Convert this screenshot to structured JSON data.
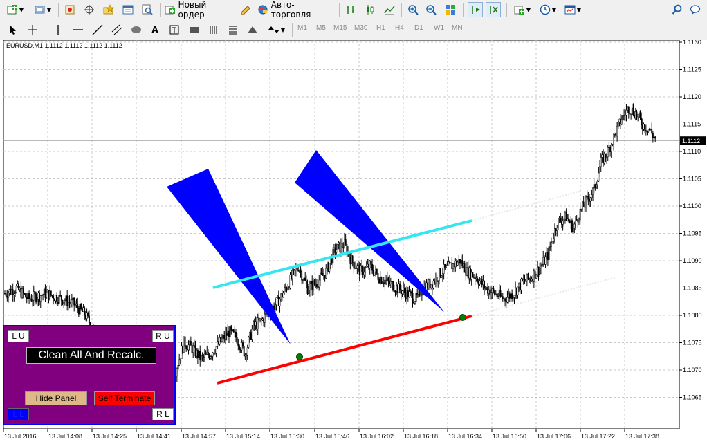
{
  "toolbar_main": {
    "new_order_label": "Новый ордер",
    "autotrading_label": "Авто-торговля"
  },
  "toolbar_draw": {
    "text_tool_label": "A",
    "timeframes": [
      "M1",
      "M5",
      "M15",
      "M30",
      "H1",
      "H4",
      "D1",
      "W1",
      "MN"
    ]
  },
  "chart": {
    "header": "EURUSD,M1  1.1112 1.1112 1.1112 1.1112",
    "current_price": "1.1112",
    "colors": {
      "background": "#ffffff",
      "grid": "#c8c8c8",
      "candles": "#000000",
      "triangles": "#0000ff",
      "upper_line": "#33e6f0",
      "lower_line": "#ff0000",
      "pivot": "#008000"
    }
  },
  "chart_data": {
    "type": "candlestick",
    "symbol": "EURUSD",
    "timeframe": "M1",
    "y_ticks": [
      "1.1130",
      "1.1125",
      "1.1120",
      "1.1115",
      "1.1110",
      "1.1105",
      "1.1100",
      "1.1095",
      "1.1090",
      "1.1085",
      "1.1080",
      "1.1075",
      "1.1070",
      "1.1065"
    ],
    "x_ticks": [
      "13 Jul 2016",
      "13 Jul 14:08",
      "13 Jul 14:25",
      "13 Jul 14:41",
      "13 Jul 14:57",
      "13 Jul 15:14",
      "13 Jul 15:30",
      "13 Jul 15:46",
      "13 Jul 16:02",
      "13 Jul 16:18",
      "13 Jul 16:34",
      "13 Jul 16:50",
      "13 Jul 17:06",
      "13 Jul 17:22",
      "13 Jul 17:38"
    ],
    "ylim": [
      1.1062,
      1.1131
    ],
    "last_price": 1.1112,
    "close_path": [
      [
        0,
        1.1084
      ],
      [
        10,
        1.1085
      ],
      [
        20,
        1.1083
      ],
      [
        35,
        1.1084
      ],
      [
        50,
        1.1083
      ],
      [
        60,
        1.1082
      ],
      [
        70,
        1.108
      ],
      [
        80,
        1.1076
      ],
      [
        90,
        1.1073
      ],
      [
        100,
        1.1071
      ],
      [
        110,
        1.107
      ],
      [
        118,
        1.1073
      ],
      [
        125,
        1.107
      ],
      [
        133,
        1.1068
      ],
      [
        140,
        1.1067
      ],
      [
        148,
        1.107
      ],
      [
        155,
        1.1075
      ],
      [
        162,
        1.1074
      ],
      [
        170,
        1.1072
      ],
      [
        178,
        1.1073
      ],
      [
        186,
        1.1075
      ],
      [
        194,
        1.1077
      ],
      [
        200,
        1.1076
      ],
      [
        208,
        1.1073
      ],
      [
        215,
        1.1078
      ],
      [
        222,
        1.1079
      ],
      [
        230,
        1.1081
      ],
      [
        238,
        1.1083
      ],
      [
        246,
        1.1086
      ],
      [
        254,
        1.1089
      ],
      [
        262,
        1.1085
      ],
      [
        270,
        1.1086
      ],
      [
        278,
        1.1088
      ],
      [
        286,
        1.1092
      ],
      [
        294,
        1.1093
      ],
      [
        300,
        1.109
      ],
      [
        308,
        1.1088
      ],
      [
        316,
        1.1089
      ],
      [
        324,
        1.1087
      ],
      [
        332,
        1.1086
      ],
      [
        340,
        1.1085
      ],
      [
        348,
        1.1084
      ],
      [
        356,
        1.1083
      ],
      [
        362,
        1.1085
      ],
      [
        370,
        1.1086
      ],
      [
        378,
        1.1088
      ],
      [
        386,
        1.1089
      ],
      [
        394,
        1.109
      ],
      [
        400,
        1.1088
      ],
      [
        408,
        1.1087
      ],
      [
        416,
        1.1085
      ],
      [
        424,
        1.1084
      ],
      [
        432,
        1.1083
      ],
      [
        440,
        1.1084
      ],
      [
        448,
        1.1086
      ],
      [
        456,
        1.1087
      ],
      [
        464,
        1.1089
      ],
      [
        470,
        1.1091
      ],
      [
        478,
        1.1097
      ],
      [
        486,
        1.1098
      ],
      [
        492,
        1.1096
      ],
      [
        498,
        1.1099
      ],
      [
        504,
        1.1101
      ],
      [
        510,
        1.1103
      ],
      [
        516,
        1.1108
      ],
      [
        522,
        1.111
      ],
      [
        528,
        1.1113
      ],
      [
        534,
        1.1116
      ],
      [
        540,
        1.1118
      ],
      [
        546,
        1.1117
      ],
      [
        552,
        1.1115
      ],
      [
        558,
        1.1114
      ],
      [
        564,
        1.1112
      ]
    ],
    "lines": [
      {
        "name": "upper",
        "from": [
          10,
          1.1086
        ],
        "to": [
          123,
          1.1098
        ]
      },
      {
        "name": "lower",
        "from": [
          15,
          1.1068
        ],
        "to": [
          123,
          1.108
        ]
      }
    ],
    "pivots": [
      [
        51,
        1.1073
      ],
      [
        122,
        1.108
      ]
    ]
  },
  "panel": {
    "lu_label": "L U",
    "ru_label": "R U",
    "clean_label": "Clean All And Recalc.",
    "hide_label": "Hide Panel",
    "terminate_label": "Self Terminate",
    "ll_label": "L L",
    "rl_label": "R L"
  }
}
